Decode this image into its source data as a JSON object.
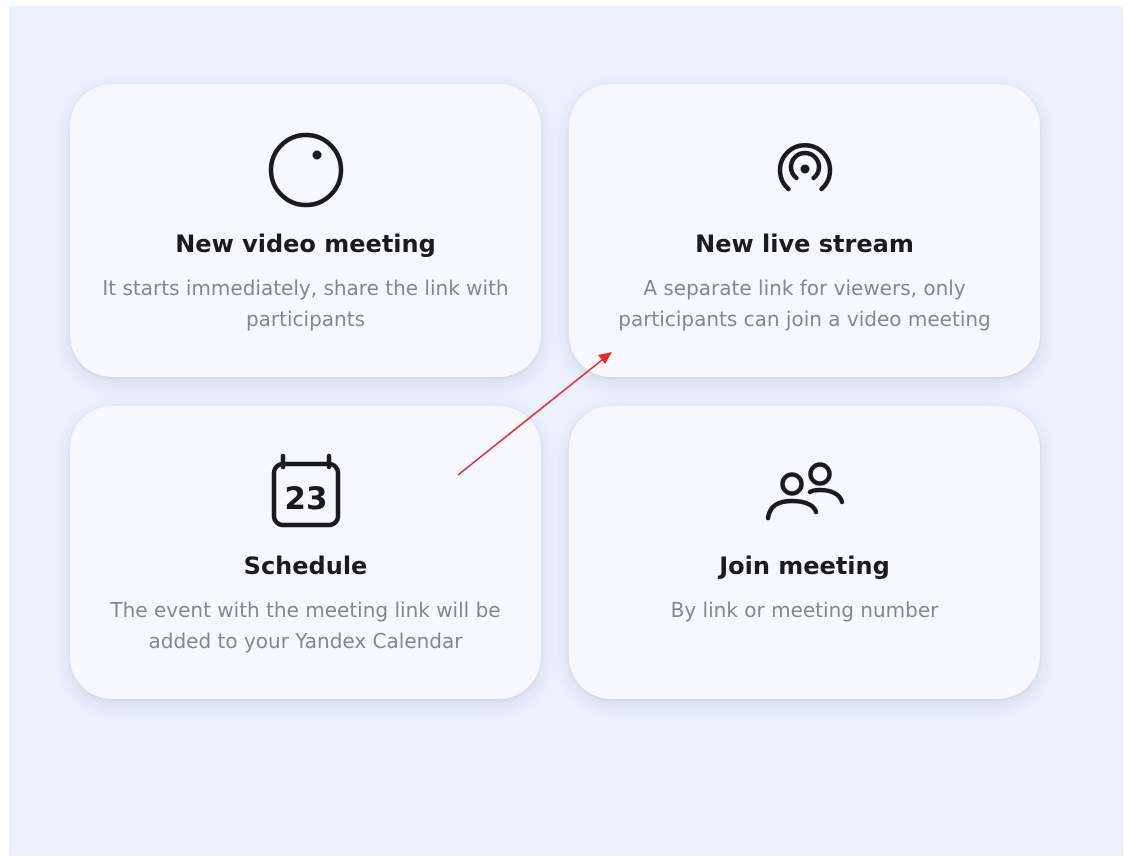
{
  "colors": {
    "background": "#ecf1fd",
    "card": "#f6f8fe",
    "title": "#1b1b1f",
    "description": "#85878f",
    "icon": "#1b1b1f",
    "annotation_arrow": "#e8262b"
  },
  "cards": [
    {
      "icon": "circle-dot-icon",
      "title": "New video meeting",
      "description": "It starts immediately, share the link with participants"
    },
    {
      "icon": "broadcast-icon",
      "title": "New live stream",
      "description": "A separate link for viewers, only participants can join a video meeting"
    },
    {
      "icon": "calendar-icon",
      "calendar_day": "23",
      "title": "Schedule",
      "description": "The event with the meeting link will be added to your Yandex Calendar"
    },
    {
      "icon": "people-icon",
      "title": "Join meeting",
      "description": "By link or meeting number"
    }
  ],
  "annotation": {
    "type": "arrow",
    "points_to": "new-live-stream-card"
  }
}
